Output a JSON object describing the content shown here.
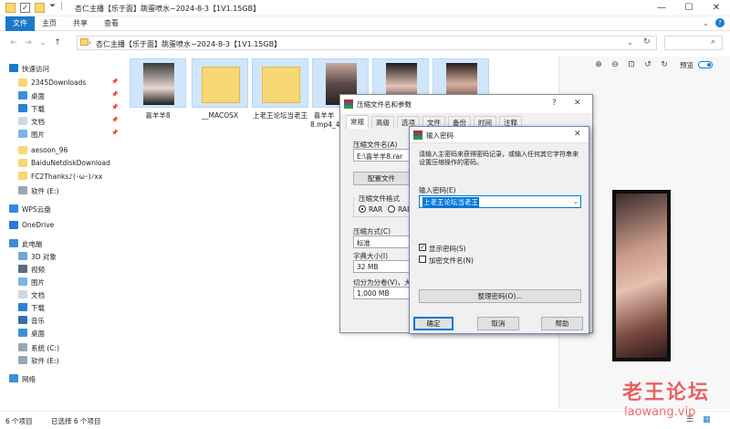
{
  "window": {
    "title": "杏仁主播【乐于面】跳蛋喷水~2024-8-3【1V1.15GB】",
    "controls": [
      "—",
      "☐",
      "✕"
    ]
  },
  "ribbon": {
    "tabs": [
      "文件",
      "主页",
      "共享",
      "查看"
    ]
  },
  "address": {
    "path_root": "›",
    "path": "杏仁主播【乐于面】跳蛋喷水~2024-8-3【1V1.15GB】",
    "dropdown": "⌄",
    "refresh": "↻"
  },
  "sidebar": {
    "items": [
      {
        "label": "快速访问",
        "icon": "star-icon",
        "pinned": false
      },
      {
        "label": "2345Downloads",
        "icon": "folder-icon",
        "pinned": true
      },
      {
        "label": "桌面",
        "icon": "desktop-icon",
        "pinned": true
      },
      {
        "label": "下载",
        "icon": "download-icon",
        "pinned": true
      },
      {
        "label": "文档",
        "icon": "document-icon",
        "pinned": true
      },
      {
        "label": "图片",
        "icon": "picture-icon",
        "pinned": true
      },
      {
        "label": "aesoon_96",
        "icon": "folder-icon",
        "pinned": false
      },
      {
        "label": "BaiduNetdiskDownload",
        "icon": "folder-icon",
        "pinned": false
      },
      {
        "label": "FC2Thanks♪(･ω･)ﾉxx",
        "icon": "folder-icon",
        "pinned": false
      },
      {
        "label": "软件 (E:)",
        "icon": "drive-icon",
        "pinned": false
      },
      {
        "label": "WPS云盘",
        "icon": "cloud-icon",
        "pinned": false
      },
      {
        "label": "OneDrive",
        "icon": "onedrive-icon",
        "pinned": false
      },
      {
        "label": "此电脑",
        "icon": "computer-icon",
        "pinned": false
      },
      {
        "label": "3D 对象",
        "icon": "cube-icon",
        "pinned": false
      },
      {
        "label": "视频",
        "icon": "video-icon",
        "pinned": false
      },
      {
        "label": "图片",
        "icon": "picture-icon",
        "pinned": false
      },
      {
        "label": "文档",
        "icon": "document-icon",
        "pinned": false
      },
      {
        "label": "下载",
        "icon": "download-icon",
        "pinned": false
      },
      {
        "label": "音乐",
        "icon": "music-icon",
        "pinned": false
      },
      {
        "label": "桌面",
        "icon": "desktop-icon",
        "pinned": false
      },
      {
        "label": "系统 (C:)",
        "icon": "drive-icon",
        "pinned": false
      },
      {
        "label": "软件 (E:)",
        "icon": "drive-icon",
        "pinned": false
      },
      {
        "label": "网络",
        "icon": "network-icon",
        "pinned": false
      }
    ]
  },
  "files": [
    {
      "label": "喜羊羊8",
      "kind": "image"
    },
    {
      "label": "__MACOSX",
      "kind": "folder"
    },
    {
      "label": "上老王论坛当老王",
      "kind": "folder"
    },
    {
      "label": "喜羊羊8.mp4_4_18",
      "kind": "image"
    },
    {
      "label": "",
      "kind": "image"
    },
    {
      "label": "",
      "kind": "image"
    }
  ],
  "preview": {
    "toggle_label": "预览"
  },
  "status": {
    "count": "6 个项目",
    "selected": "已选择 6 个项目"
  },
  "archive_dialog": {
    "title": "压缩文件名和参数",
    "help": "?",
    "close": "✕",
    "tabs": [
      "常规",
      "高级",
      "选项",
      "文件",
      "备份",
      "时间",
      "注释"
    ],
    "archive_name_label": "压缩文件名(A)",
    "archive_name_value": "E:\\喜羊羊8.rar",
    "profile_button": "配置文件",
    "format_group": "压缩文件格式",
    "format_rar": "RAR",
    "format_rar4": "RAR",
    "method_label": "压缩方式(C)",
    "method_value": "标准",
    "dict_label": "字典大小(I)",
    "dict_value": "32 MB",
    "split_label": "切分为分卷(V)，大",
    "split_value": "1,000 MB"
  },
  "password_dialog": {
    "title": "输入密码",
    "close": "✕",
    "description": "请输入主密码来获得密码记录，或输入任何其它字符串来设置压缩操作的密码。",
    "enter_label": "输入密码(E)",
    "password_value": "上老王论坛当老王",
    "show_password_label": "显示密码(S)",
    "show_password_checked": true,
    "encrypt_names_label": "加密文件名(N)",
    "encrypt_names_checked": false,
    "organize_button": "整理密码(O)...",
    "ok_button": "确定",
    "cancel_button": "取消",
    "help_button": "帮助"
  },
  "watermark": {
    "text": "老王论坛",
    "url": "laowang.vip"
  },
  "colors": {
    "accent": "#1979ca",
    "selection": "#cce8ff",
    "folder": "#f8d775",
    "watermark": "#e6484b"
  }
}
